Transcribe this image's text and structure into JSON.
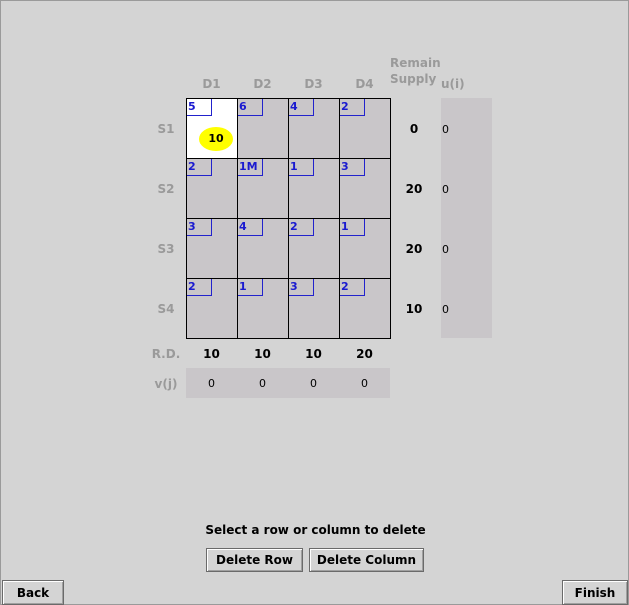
{
  "columns": [
    "D1",
    "D2",
    "D3",
    "D4"
  ],
  "rows": [
    "S1",
    "S2",
    "S3",
    "S4"
  ],
  "headers": {
    "remain_line1": "Remain",
    "remain_line2": "Supply",
    "u": "u(i)",
    "rd": "R.D.",
    "v": "v(j)"
  },
  "costs": [
    [
      "5",
      "6",
      "4",
      "2"
    ],
    [
      "2",
      "1M",
      "1",
      "3"
    ],
    [
      "3",
      "4",
      "2",
      "1"
    ],
    [
      "2",
      "1",
      "3",
      "2"
    ]
  ],
  "allocation": {
    "row": 0,
    "col": 0,
    "value": "10"
  },
  "remain_supply": [
    "0",
    "20",
    "20",
    "10"
  ],
  "u_values": [
    "0",
    "0",
    "0",
    "0"
  ],
  "remain_demand": [
    "10",
    "10",
    "10",
    "20"
  ],
  "v_values": [
    "0",
    "0",
    "0",
    "0"
  ],
  "message": "Select a row or column to delete",
  "buttons": {
    "delete_row": "Delete Row",
    "delete_column": "Delete Column",
    "back": "Back",
    "finish": "Finish"
  },
  "colors": {
    "cost_blue": "#1a1ad0",
    "highlight_yellow": "#ffff00",
    "cell_gray": "#c9c6c9",
    "header_gray": "#9a9a9a"
  }
}
